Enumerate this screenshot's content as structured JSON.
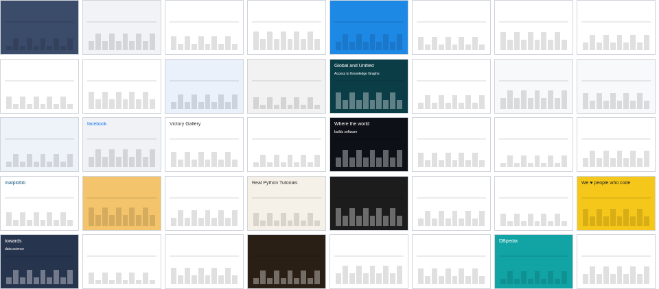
{
  "tiles": [
    {
      "t1": "",
      "t2": "",
      "bg": "#3b4b6a",
      "fg": "#ffffff",
      "kind": "hero"
    },
    {
      "t1": "",
      "t2": "",
      "bg": "#f1f3f6",
      "fg": "#333333",
      "kind": "dash"
    },
    {
      "t1": "",
      "t2": "",
      "bg": "#ffffff",
      "fg": "#333333",
      "kind": "logo"
    },
    {
      "t1": "",
      "t2": "",
      "bg": "#ffffff",
      "fg": "#2c7be5",
      "kind": "people"
    },
    {
      "t1": "",
      "t2": "",
      "bg": "#1e88e5",
      "fg": "#ffffff",
      "kind": "bluechart"
    },
    {
      "t1": "",
      "t2": "",
      "bg": "#ffffff",
      "fg": "#333333",
      "kind": "table"
    },
    {
      "t1": "",
      "t2": "",
      "bg": "#ffffff",
      "fg": "#e94b5c",
      "kind": "gantt"
    },
    {
      "t1": "",
      "t2": "",
      "bg": "#ffffff",
      "fg": "#1f77b4",
      "kind": "d3"
    },
    {
      "t1": "",
      "t2": "",
      "bg": "#ffffff",
      "fg": "#cc0000",
      "kind": "gov"
    },
    {
      "t1": "",
      "t2": "",
      "bg": "#ffffff",
      "fg": "#003399",
      "kind": "eu"
    },
    {
      "t1": "",
      "t2": "",
      "bg": "#eaf1fb",
      "fg": "#1f4e96",
      "kind": "blueband"
    },
    {
      "t1": "",
      "t2": "",
      "bg": "#f2f2f2",
      "fg": "#333333",
      "kind": "doc"
    },
    {
      "t1": "Global and Unified",
      "t2": "Access to Knowledge Graphs",
      "bg": "#0b3d46",
      "fg": "#ffffff",
      "kind": "dark"
    },
    {
      "t1": "",
      "t2": "",
      "bg": "#ffffff",
      "fg": "#2e7d32",
      "kind": "chartpage"
    },
    {
      "t1": "",
      "t2": "",
      "bg": "#f8f9fa",
      "fg": "#222222",
      "kind": "wiki"
    },
    {
      "t1": "",
      "t2": "",
      "bg": "#f8f9fa",
      "fg": "#222222",
      "kind": "wiki2"
    },
    {
      "t1": "",
      "t2": "",
      "bg": "#eef3fa",
      "fg": "#1f4e96",
      "kind": "portal"
    },
    {
      "t1": "facebook",
      "t2": "",
      "bg": "#f0f2f5",
      "fg": "#1877f2",
      "kind": "fb"
    },
    {
      "t1": "Victory Gallery",
      "t2": "",
      "bg": "#ffffff",
      "fg": "#333333",
      "kind": "victory"
    },
    {
      "t1": "",
      "t2": "",
      "bg": "#ffffff",
      "fg": "#333333",
      "kind": "wiki3"
    },
    {
      "t1": "Where the world",
      "t2": "builds software",
      "bg": "#0d1117",
      "fg": "#ffffff",
      "kind": "github"
    },
    {
      "t1": "",
      "t2": "",
      "bg": "#ffffff",
      "fg": "#333333",
      "kind": "article"
    },
    {
      "t1": "",
      "t2": "",
      "bg": "#ffffff",
      "fg": "#333333",
      "kind": "linecharts"
    },
    {
      "t1": "",
      "t2": "",
      "bg": "#ffffff",
      "fg": "#2e7d32",
      "kind": "text"
    },
    {
      "t1": "matplotlib",
      "t2": "",
      "bg": "#ffffff",
      "fg": "#11557c",
      "kind": "mpl"
    },
    {
      "t1": "",
      "t2": "",
      "bg": "#f3c46b",
      "fg": "#333333",
      "kind": "fox"
    },
    {
      "t1": "",
      "t2": "",
      "bg": "#ffffff",
      "fg": "#333333",
      "kind": "community"
    },
    {
      "t1": "Real Python Tutorials",
      "t2": "",
      "bg": "#f6f1e8",
      "fg": "#333333",
      "kind": "realpy"
    },
    {
      "t1": "",
      "t2": "",
      "bg": "#1c1c1c",
      "fg": "#ffffff",
      "kind": "screens"
    },
    {
      "t1": "",
      "t2": "",
      "bg": "#ffffff",
      "fg": "#333333",
      "kind": "wiki4"
    },
    {
      "t1": "",
      "t2": "",
      "bg": "#ffffff",
      "fg": "#333333",
      "kind": "galleryimgs"
    },
    {
      "t1": "We ♥ people who code",
      "t2": "",
      "bg": "#f5c71a",
      "fg": "#222222",
      "kind": "yellow"
    },
    {
      "t1": "towards",
      "t2": "data science",
      "bg": "#27344d",
      "fg": "#ffffff",
      "kind": "tds"
    },
    {
      "t1": "",
      "t2": "",
      "bg": "#ffffff",
      "fg": "#333333",
      "kind": "twitter"
    },
    {
      "t1": "",
      "t2": "",
      "bg": "#ffffff",
      "fg": "#333333",
      "kind": "phone"
    },
    {
      "t1": "",
      "t2": "",
      "bg": "#2a1f14",
      "fg": "#e0c28a",
      "kind": "darkweb"
    },
    {
      "t1": "",
      "t2": "",
      "bg": "#ffffff",
      "fg": "#333333",
      "kind": "mapdoc"
    },
    {
      "t1": "",
      "t2": "",
      "bg": "#ffffff",
      "fg": "#333333",
      "kind": "worldmap"
    },
    {
      "t1": "DBpedia",
      "t2": "",
      "bg": "#12a4a5",
      "fg": "#ffffff",
      "kind": "dbpedia"
    },
    {
      "t1": "",
      "t2": "",
      "bg": "#ffffff",
      "fg": "#333333",
      "kind": "sidebarviz"
    }
  ]
}
